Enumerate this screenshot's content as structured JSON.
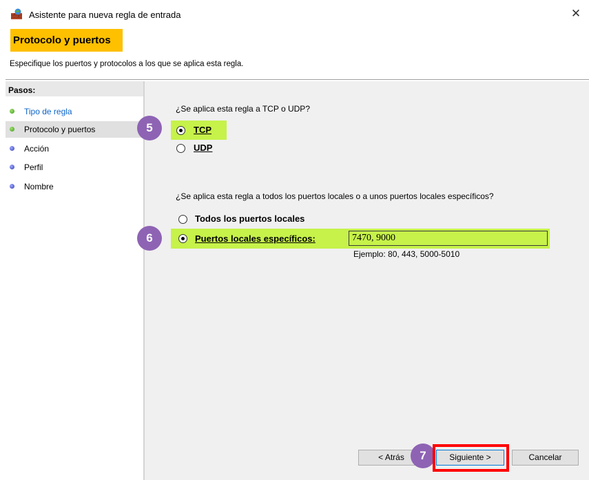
{
  "window": {
    "title": "Asistente para nueva regla de entrada",
    "close_glyph": "✕"
  },
  "header": {
    "heading": "Protocolo y puertos",
    "subtitle": "Especifique los puertos y protocolos a los que se aplica esta regla."
  },
  "steps": {
    "title": "Pasos:",
    "items": [
      {
        "label": "Tipo de regla",
        "status": "done"
      },
      {
        "label": "Protocolo y puertos",
        "status": "current"
      },
      {
        "label": "Acción",
        "status": "pending"
      },
      {
        "label": "Perfil",
        "status": "pending"
      },
      {
        "label": "Nombre",
        "status": "pending"
      }
    ]
  },
  "protocol": {
    "question": "¿Se aplica esta regla a TCP o UDP?",
    "tcp_label": "TCP",
    "udp_label": "UDP",
    "selected": "TCP"
  },
  "ports": {
    "question": "¿Se aplica esta regla a todos los puertos locales o a unos puertos locales específicos?",
    "all_label": "Todos los puertos locales",
    "specific_label": "Puertos locales específicos:",
    "selected": "specific",
    "value": "7470, 9000",
    "example": "Ejemplo: 80, 443, 5000-5010"
  },
  "annotations": {
    "badge_5": "5",
    "badge_6": "6",
    "badge_7": "7"
  },
  "buttons": {
    "back": "< Atrás",
    "next": "Siguiente >",
    "cancel": "Cancelar"
  },
  "colors": {
    "heading_bg": "#ffc000",
    "highlight": "#c6f24a",
    "badge": "#8e63b4",
    "annotation_frame": "#ff0000",
    "link": "#0b63c9"
  },
  "icons": {
    "app": "firewall-wizard-icon",
    "close": "close-icon",
    "step_done": "green-dot-icon",
    "step_pending": "blue-dot-icon"
  }
}
